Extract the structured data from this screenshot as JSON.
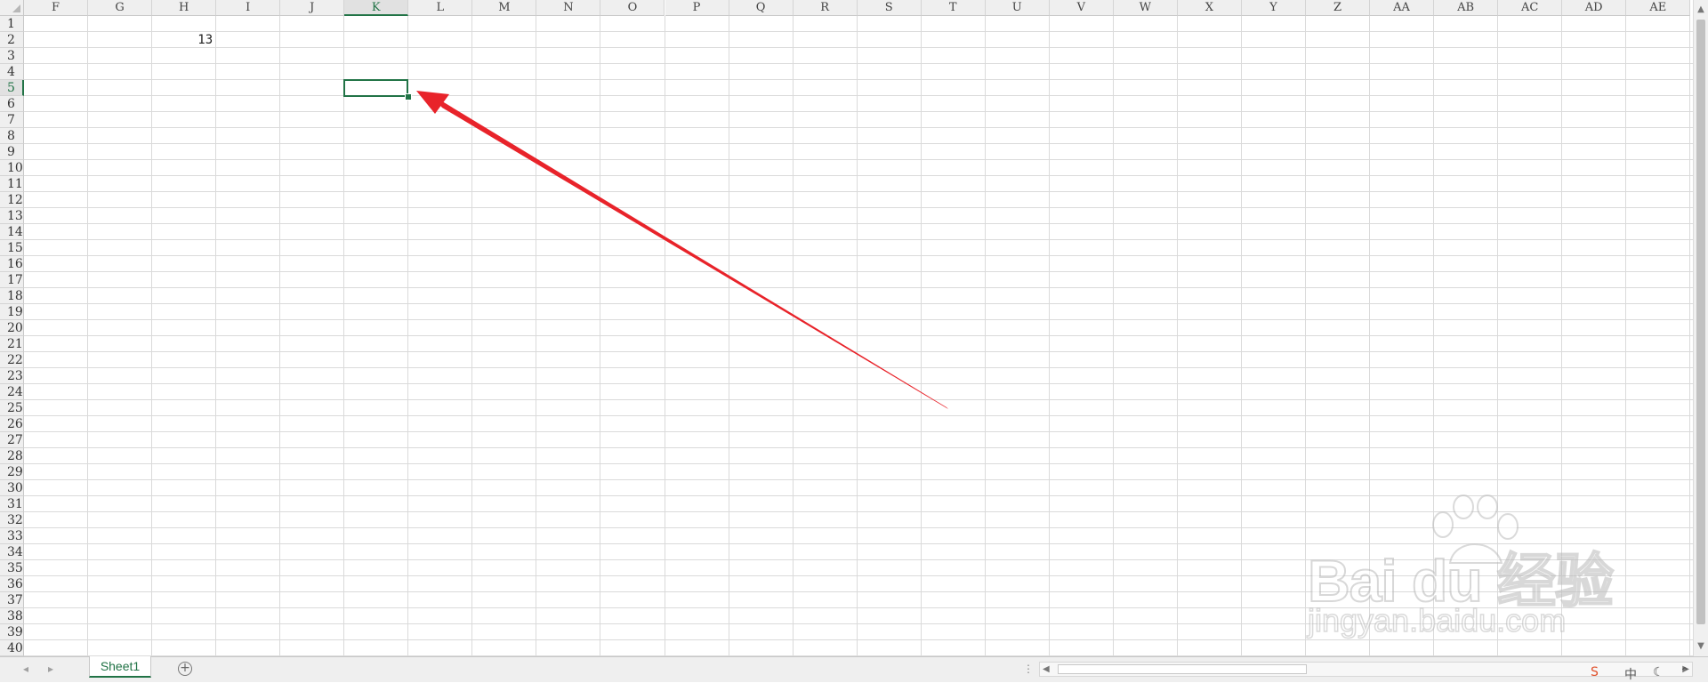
{
  "app": {
    "name": "Spreadsheet"
  },
  "columns": [
    "F",
    "G",
    "H",
    "I",
    "J",
    "K",
    "L",
    "M",
    "N",
    "O",
    "P",
    "Q",
    "R",
    "S",
    "T",
    "U",
    "V",
    "W",
    "X",
    "Y",
    "Z",
    "AA",
    "AB",
    "AC",
    "AD",
    "AE"
  ],
  "rows": [
    "1",
    "2",
    "3",
    "4",
    "5",
    "6",
    "7",
    "8",
    "9",
    "10",
    "11",
    "12",
    "13",
    "14",
    "15",
    "16",
    "17",
    "18",
    "19",
    "20",
    "21",
    "22",
    "23",
    "24",
    "25",
    "26",
    "27",
    "28",
    "29",
    "30",
    "31",
    "32",
    "33",
    "34",
    "35",
    "36",
    "37",
    "38",
    "39",
    "40"
  ],
  "selected_cell": {
    "column": "K",
    "row": "5"
  },
  "cells": [
    {
      "column": "H",
      "row": "2",
      "value": "13"
    }
  ],
  "sheet_tabs": [
    {
      "label": "Sheet1",
      "active": true
    }
  ],
  "add_sheet_label": "+",
  "watermark": {
    "brand": "Bai du 经验",
    "url": "jingyan.baidu.com"
  },
  "annotation_arrow_color": "#e8232a",
  "accent_color": "#217346",
  "tray": {
    "ime_label": "中"
  }
}
